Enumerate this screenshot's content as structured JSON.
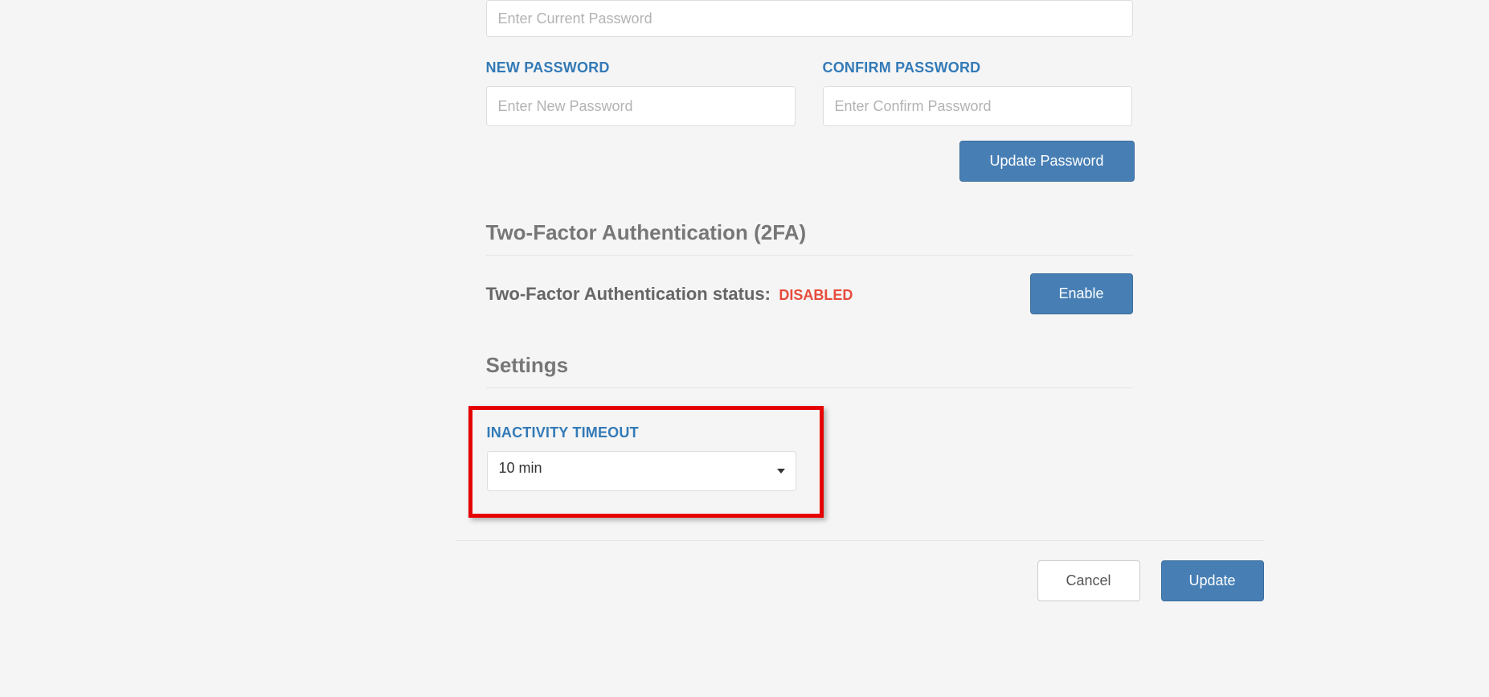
{
  "password_section": {
    "current_password_placeholder": "Enter Current Password",
    "new_password_label": "NEW PASSWORD",
    "new_password_placeholder": "Enter New Password",
    "confirm_password_label": "CONFIRM PASSWORD",
    "confirm_password_placeholder": "Enter Confirm Password",
    "update_password_button": "Update Password"
  },
  "twofa_section": {
    "heading": "Two-Factor Authentication (2FA)",
    "status_label": "Two-Factor Authentication status:",
    "status_value": "DISABLED",
    "enable_button": "Enable"
  },
  "settings_section": {
    "heading": "Settings",
    "inactivity_timeout_label": "INACTIVITY TIMEOUT",
    "inactivity_timeout_value": "10 min"
  },
  "footer": {
    "cancel_button": "Cancel",
    "update_button": "Update"
  }
}
